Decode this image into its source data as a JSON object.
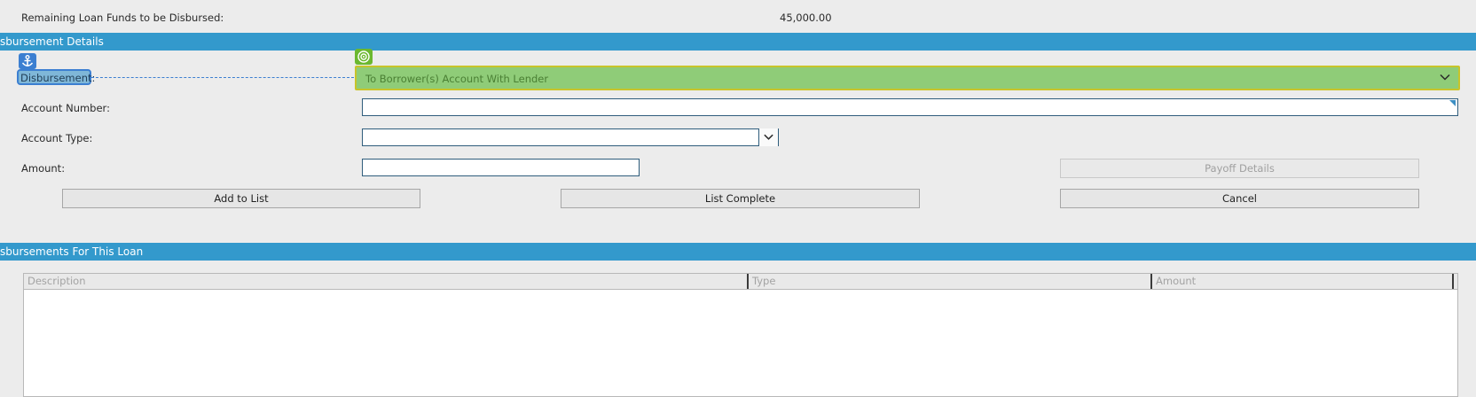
{
  "summary": {
    "remaining_label": "Remaining Loan Funds to be Disbursed:",
    "remaining_value": "45,000.00"
  },
  "details_section": {
    "title": "sbursement Details",
    "disbursement_label": "Disbursement:",
    "disbursement_value": "To Borrower(s) Account With Lender",
    "account_number_label": "Account Number:",
    "account_number_value": "",
    "account_type_label": "Account Type:",
    "account_type_value": "",
    "amount_label": "Amount:",
    "amount_value": "",
    "buttons": {
      "payoff": "Payoff Details",
      "add": "Add to List",
      "complete": "List Complete",
      "cancel": "Cancel"
    }
  },
  "list_section": {
    "title": "sbursements For This Loan",
    "columns": [
      "Description",
      "Type",
      "Amount"
    ]
  },
  "icons": {
    "anchor": "anchor-icon",
    "target": "target-icon",
    "dropdown": "chevron-down-icon"
  },
  "colors": {
    "section_bar": "#3399cc",
    "highlight_green": "#8fcc78",
    "anchor_blue": "#3c7fd1"
  }
}
